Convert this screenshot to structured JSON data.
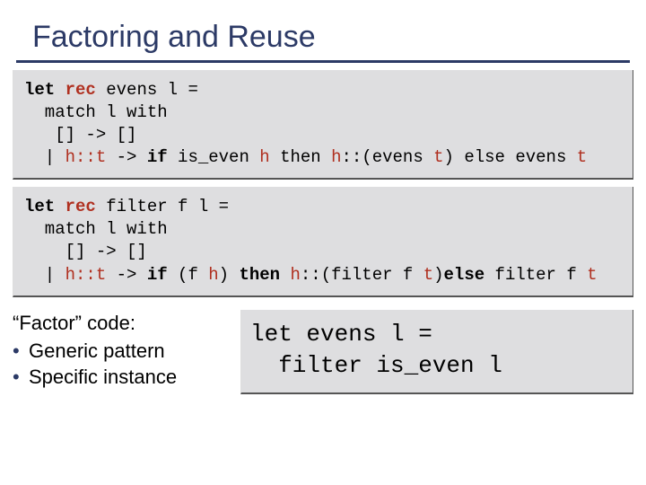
{
  "title": "Factoring and Reuse",
  "code1": {
    "line1_a": "let",
    "line1_b": "rec",
    "line1_c": " evens l =",
    "line2": "  match l with",
    "line3": "   [] -> []",
    "line4_a": "  | ",
    "line4_b": "h::t",
    "line4_c": " -> ",
    "line4_d": "if",
    "line4_e": " is_even ",
    "line4_f": "h",
    "line4_g": " then ",
    "line4_h": "h",
    "line4_i": "::(evens ",
    "line4_j": "t",
    "line4_k": ") else evens ",
    "line4_l": "t"
  },
  "code2": {
    "line1_a": "let",
    "line1_b": "rec",
    "line1_c": " filter f l =",
    "line2": "  match l with",
    "line3": "    [] -> []",
    "line4_a": "  | ",
    "line4_b": "h::t",
    "line4_c": " -> ",
    "line4_d": "if",
    "line4_e": " (f ",
    "line4_f": "h",
    "line4_g": ") ",
    "line4_h": "then ",
    "line4_i": "h",
    "line4_j": "::(filter f ",
    "line4_k": "t",
    "line4_l": ")",
    "line4_m": "else",
    "line4_n": " filter f ",
    "line4_o": "t"
  },
  "bullets": {
    "head": "“Factor” code:",
    "b1": "Generic pattern",
    "b2": "Specific instance"
  },
  "factor": {
    "line1_a": "let",
    "line1_b": " evens l =",
    "line2": "  filter is_even l"
  }
}
